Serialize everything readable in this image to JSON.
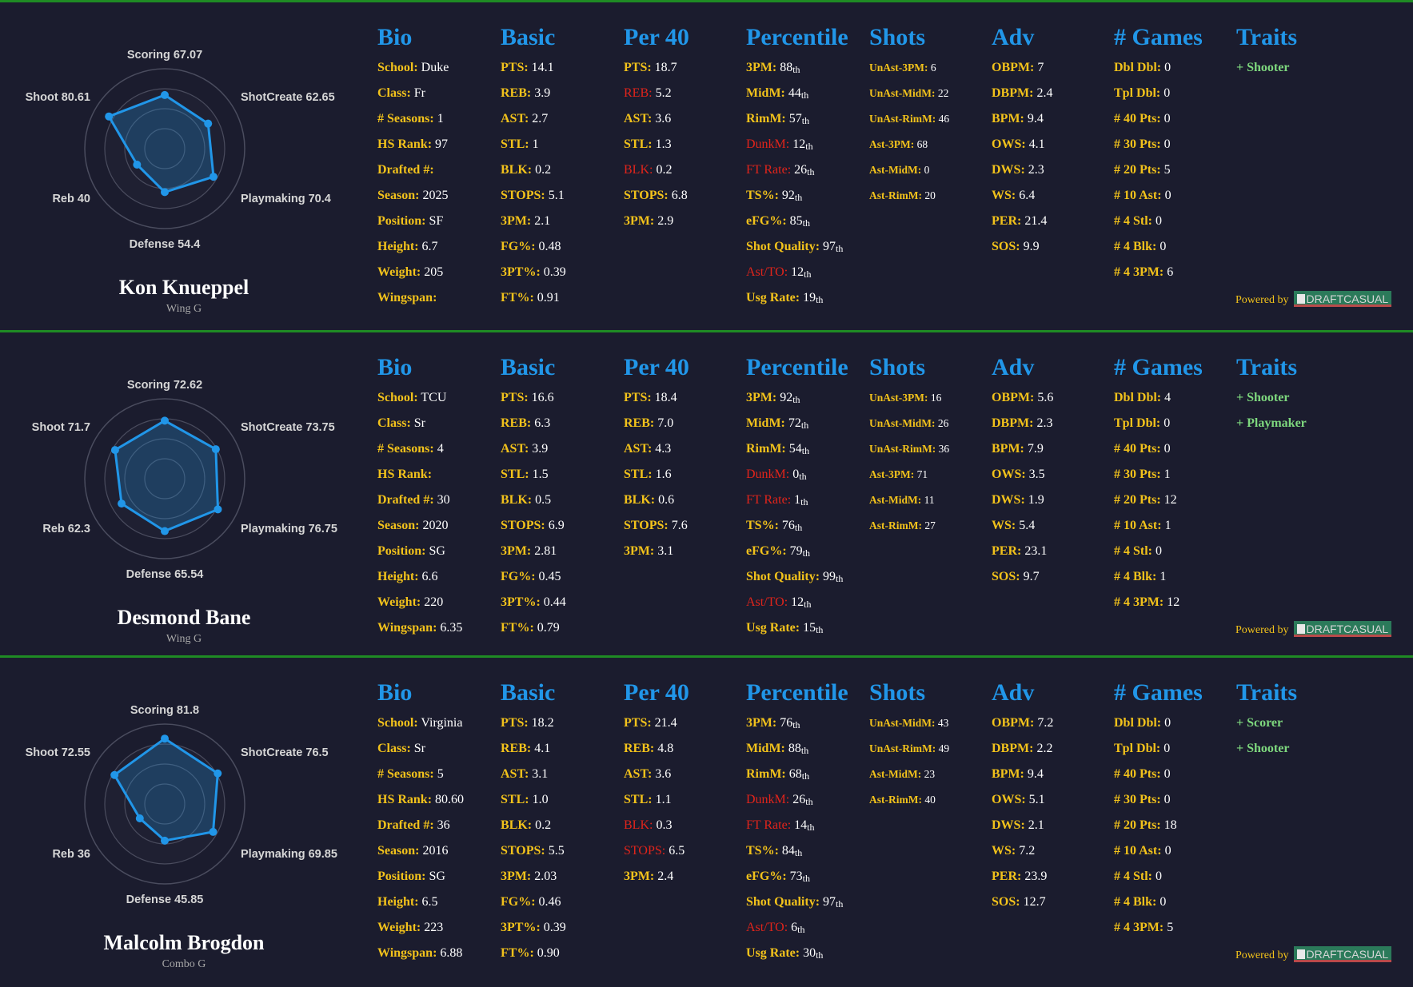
{
  "headers": {
    "bio": "Bio",
    "basic": "Basic",
    "per40": "Per 40",
    "percentile": "Percentile",
    "shots": "Shots",
    "adv": "Adv",
    "games": "# Games",
    "traits": "Traits"
  },
  "powered_by": "Powered by",
  "brand": "DRAFTCASUAL",
  "colors": {
    "background": "#1b1c2e",
    "divider": "#1f8b24",
    "header": "#2196e8",
    "key": "#f2c21b",
    "key_red": "#e0241b",
    "value": "#ffffff",
    "trait": "#7ed87e",
    "radar_line": "#2196e8"
  },
  "radar_axes": [
    "Scoring",
    "ShotCreate",
    "Playmaking",
    "Defense",
    "Reb",
    "Shoot"
  ],
  "players": [
    {
      "name": "Kon Knueppel",
      "position": "Wing G",
      "radar": {
        "scoring": {
          "label": "Scoring 67.07",
          "value": 67.07
        },
        "shotcreate": {
          "label": "ShotCreate 62.65",
          "value": 62.65
        },
        "playmaking": {
          "label": "Playmaking 70.4",
          "value": 70.4
        },
        "defense": {
          "label": "Defense 54.4",
          "value": 54.4
        },
        "reb": {
          "label": "Reb 40",
          "value": 40
        },
        "shoot": {
          "label": "Shoot 80.61",
          "value": 80.61
        }
      },
      "bio": [
        {
          "k": "School:",
          "v": "Duke"
        },
        {
          "k": "Class:",
          "v": "Fr"
        },
        {
          "k": "# Seasons:",
          "v": "1"
        },
        {
          "k": "HS Rank:",
          "v": "97"
        },
        {
          "k": "Drafted #:",
          "v": ""
        },
        {
          "k": "Season:",
          "v": "2025"
        },
        {
          "k": "Position:",
          "v": "SF"
        },
        {
          "k": "Height:",
          "v": "6.7"
        },
        {
          "k": "Weight:",
          "v": "205"
        },
        {
          "k": "Wingspan:",
          "v": ""
        }
      ],
      "basic": [
        {
          "k": "PTS:",
          "v": "14.1"
        },
        {
          "k": "REB:",
          "v": "3.9"
        },
        {
          "k": "AST:",
          "v": "2.7"
        },
        {
          "k": "STL:",
          "v": "1"
        },
        {
          "k": "BLK:",
          "v": "0.2"
        },
        {
          "k": "STOPS:",
          "v": "5.1"
        },
        {
          "k": "3PM:",
          "v": "2.1"
        },
        {
          "k": "FG%:",
          "v": "0.48"
        },
        {
          "k": "3PT%:",
          "v": "0.39"
        },
        {
          "k": "FT%:",
          "v": "0.91"
        }
      ],
      "per40": [
        {
          "k": "PTS:",
          "v": "18.7"
        },
        {
          "k": "REB:",
          "v": "5.2",
          "red": true
        },
        {
          "k": "AST:",
          "v": "3.6"
        },
        {
          "k": "STL:",
          "v": "1.3"
        },
        {
          "k": "BLK:",
          "v": "0.2",
          "red": true
        },
        {
          "k": "STOPS:",
          "v": "6.8"
        },
        {
          "k": "3PM:",
          "v": "2.9"
        }
      ],
      "percentile": [
        {
          "k": "3PM:",
          "n": "88",
          "s": "th"
        },
        {
          "k": "MidM:",
          "n": "44",
          "s": "th"
        },
        {
          "k": "RimM:",
          "n": "57",
          "s": "th"
        },
        {
          "k": "DunkM:",
          "n": "12",
          "s": "th",
          "red": true
        },
        {
          "k": "FT Rate:",
          "n": "26",
          "s": "th",
          "red": true
        },
        {
          "k": "TS%:",
          "n": "92",
          "s": "th"
        },
        {
          "k": "eFG%:",
          "n": "85",
          "s": "th"
        },
        {
          "k": "Shot Quality:",
          "n": "97",
          "s": "th"
        },
        {
          "k": "Ast/TO:",
          "n": "12",
          "s": "th",
          "red": true
        },
        {
          "k": "Usg Rate:",
          "n": "19",
          "s": "th"
        }
      ],
      "shots": [
        {
          "k": "UnAst-3PM:",
          "v": "6"
        },
        {
          "k": "UnAst-MidM:",
          "v": "22"
        },
        {
          "k": "UnAst-RimM:",
          "v": "46"
        },
        {
          "k": "Ast-3PM:",
          "v": "68"
        },
        {
          "k": "Ast-MidM:",
          "v": "0"
        },
        {
          "k": "Ast-RimM:",
          "v": "20"
        }
      ],
      "adv": [
        {
          "k": "OBPM:",
          "v": "7"
        },
        {
          "k": "DBPM:",
          "v": "2.4"
        },
        {
          "k": "BPM:",
          "v": "9.4"
        },
        {
          "k": "OWS:",
          "v": "4.1"
        },
        {
          "k": "DWS:",
          "v": "2.3"
        },
        {
          "k": "WS:",
          "v": "6.4"
        },
        {
          "k": "PER:",
          "v": "21.4"
        },
        {
          "k": "SOS:",
          "v": "9.9"
        }
      ],
      "games": [
        {
          "k": "Dbl Dbl:",
          "v": "0"
        },
        {
          "k": "Tpl Dbl:",
          "v": "0"
        },
        {
          "k": "# 40 Pts:",
          "v": "0"
        },
        {
          "k": "# 30 Pts:",
          "v": "0"
        },
        {
          "k": "# 20 Pts:",
          "v": "5"
        },
        {
          "k": "# 10 Ast:",
          "v": "0"
        },
        {
          "k": "# 4 Stl:",
          "v": "0"
        },
        {
          "k": "# 4 Blk:",
          "v": "0"
        },
        {
          "k": "# 4 3PM:",
          "v": "6"
        }
      ],
      "traits": [
        "+ Shooter"
      ]
    },
    {
      "name": "Desmond Bane",
      "position": "Wing G",
      "radar": {
        "scoring": {
          "label": "Scoring 72.62",
          "value": 72.62
        },
        "shotcreate": {
          "label": "ShotCreate 73.75",
          "value": 73.75
        },
        "playmaking": {
          "label": "Playmaking 76.75",
          "value": 76.75
        },
        "defense": {
          "label": "Defense 65.54",
          "value": 65.54
        },
        "reb": {
          "label": "Reb 62.3",
          "value": 62.3
        },
        "shoot": {
          "label": "Shoot 71.7",
          "value": 71.7
        }
      },
      "bio": [
        {
          "k": "School:",
          "v": "TCU"
        },
        {
          "k": "Class:",
          "v": "Sr"
        },
        {
          "k": "# Seasons:",
          "v": "4"
        },
        {
          "k": "HS Rank:",
          "v": ""
        },
        {
          "k": "Drafted #:",
          "v": "30"
        },
        {
          "k": "Season:",
          "v": "2020"
        },
        {
          "k": "Position:",
          "v": "SG"
        },
        {
          "k": "Height:",
          "v": "6.6"
        },
        {
          "k": "Weight:",
          "v": "220"
        },
        {
          "k": "Wingspan:",
          "v": "6.35"
        }
      ],
      "basic": [
        {
          "k": "PTS:",
          "v": "16.6"
        },
        {
          "k": "REB:",
          "v": "6.3"
        },
        {
          "k": "AST:",
          "v": "3.9"
        },
        {
          "k": "STL:",
          "v": "1.5"
        },
        {
          "k": "BLK:",
          "v": "0.5"
        },
        {
          "k": "STOPS:",
          "v": "6.9"
        },
        {
          "k": "3PM:",
          "v": "2.81"
        },
        {
          "k": "FG%:",
          "v": "0.45"
        },
        {
          "k": "3PT%:",
          "v": "0.44"
        },
        {
          "k": "FT%:",
          "v": "0.79"
        }
      ],
      "per40": [
        {
          "k": "PTS:",
          "v": "18.4"
        },
        {
          "k": "REB:",
          "v": "7.0"
        },
        {
          "k": "AST:",
          "v": "4.3"
        },
        {
          "k": "STL:",
          "v": "1.6"
        },
        {
          "k": "BLK:",
          "v": "0.6"
        },
        {
          "k": "STOPS:",
          "v": "7.6"
        },
        {
          "k": "3PM:",
          "v": "3.1"
        }
      ],
      "percentile": [
        {
          "k": "3PM:",
          "n": "92",
          "s": "th"
        },
        {
          "k": "MidM:",
          "n": "72",
          "s": "th"
        },
        {
          "k": "RimM:",
          "n": "54",
          "s": "th"
        },
        {
          "k": "DunkM:",
          "n": "0",
          "s": "th",
          "red": true
        },
        {
          "k": "FT Rate:",
          "n": "1",
          "s": "th",
          "red": true
        },
        {
          "k": "TS%:",
          "n": "76",
          "s": "th"
        },
        {
          "k": "eFG%:",
          "n": "79",
          "s": "th"
        },
        {
          "k": "Shot Quality:",
          "n": "99",
          "s": "th"
        },
        {
          "k": "Ast/TO:",
          "n": "12",
          "s": "th",
          "red": true
        },
        {
          "k": "Usg Rate:",
          "n": "15",
          "s": "th"
        }
      ],
      "shots": [
        {
          "k": "UnAst-3PM:",
          "v": "16"
        },
        {
          "k": "UnAst-MidM:",
          "v": "26"
        },
        {
          "k": "UnAst-RimM:",
          "v": "36"
        },
        {
          "k": "Ast-3PM:",
          "v": "71"
        },
        {
          "k": "Ast-MidM:",
          "v": "11"
        },
        {
          "k": "Ast-RimM:",
          "v": "27"
        }
      ],
      "adv": [
        {
          "k": "OBPM:",
          "v": "5.6"
        },
        {
          "k": "DBPM:",
          "v": "2.3"
        },
        {
          "k": "BPM:",
          "v": "7.9"
        },
        {
          "k": "OWS:",
          "v": "3.5"
        },
        {
          "k": "DWS:",
          "v": "1.9"
        },
        {
          "k": "WS:",
          "v": "5.4"
        },
        {
          "k": "PER:",
          "v": "23.1"
        },
        {
          "k": "SOS:",
          "v": "9.7"
        }
      ],
      "games": [
        {
          "k": "Dbl Dbl:",
          "v": "4"
        },
        {
          "k": "Tpl Dbl:",
          "v": "0"
        },
        {
          "k": "# 40 Pts:",
          "v": "0"
        },
        {
          "k": "# 30 Pts:",
          "v": "1"
        },
        {
          "k": "# 20 Pts:",
          "v": "12"
        },
        {
          "k": "# 10 Ast:",
          "v": "1"
        },
        {
          "k": "# 4 Stl:",
          "v": "0"
        },
        {
          "k": "# 4 Blk:",
          "v": "1"
        },
        {
          "k": "# 4 3PM:",
          "v": "12"
        }
      ],
      "traits": [
        "+ Shooter",
        "+ Playmaker"
      ]
    },
    {
      "name": "Malcolm Brogdon",
      "position": "Combo G",
      "radar": {
        "scoring": {
          "label": "Scoring 81.8",
          "value": 81.8
        },
        "shotcreate": {
          "label": "ShotCreate 76.5",
          "value": 76.5
        },
        "playmaking": {
          "label": "Playmaking 69.85",
          "value": 69.85
        },
        "defense": {
          "label": "Defense 45.85",
          "value": 45.85
        },
        "reb": {
          "label": "Reb 36",
          "value": 36
        },
        "shoot": {
          "label": "Shoot 72.55",
          "value": 72.55
        }
      },
      "bio": [
        {
          "k": "School:",
          "v": "Virginia"
        },
        {
          "k": "Class:",
          "v": "Sr"
        },
        {
          "k": "# Seasons:",
          "v": "5"
        },
        {
          "k": "HS Rank:",
          "v": "80.60"
        },
        {
          "k": "Drafted #:",
          "v": "36"
        },
        {
          "k": "Season:",
          "v": "2016"
        },
        {
          "k": "Position:",
          "v": "SG"
        },
        {
          "k": "Height:",
          "v": "6.5"
        },
        {
          "k": "Weight:",
          "v": "223"
        },
        {
          "k": "Wingspan:",
          "v": "6.88"
        }
      ],
      "basic": [
        {
          "k": "PTS:",
          "v": "18.2"
        },
        {
          "k": "REB:",
          "v": "4.1"
        },
        {
          "k": "AST:",
          "v": "3.1"
        },
        {
          "k": "STL:",
          "v": "1.0"
        },
        {
          "k": "BLK:",
          "v": "0.2"
        },
        {
          "k": "STOPS:",
          "v": "5.5"
        },
        {
          "k": "3PM:",
          "v": "2.03"
        },
        {
          "k": "FG%:",
          "v": "0.46"
        },
        {
          "k": "3PT%:",
          "v": "0.39"
        },
        {
          "k": "FT%:",
          "v": "0.90"
        }
      ],
      "per40": [
        {
          "k": "PTS:",
          "v": "21.4"
        },
        {
          "k": "REB:",
          "v": "4.8"
        },
        {
          "k": "AST:",
          "v": "3.6"
        },
        {
          "k": "STL:",
          "v": "1.1"
        },
        {
          "k": "BLK:",
          "v": "0.3",
          "red": true
        },
        {
          "k": "STOPS:",
          "v": "6.5",
          "red": true
        },
        {
          "k": "3PM:",
          "v": "2.4"
        }
      ],
      "percentile": [
        {
          "k": "3PM:",
          "n": "76",
          "s": "th"
        },
        {
          "k": "MidM:",
          "n": "88",
          "s": "th"
        },
        {
          "k": "RimM:",
          "n": "68",
          "s": "th"
        },
        {
          "k": "DunkM:",
          "n": "26",
          "s": "th",
          "red": true
        },
        {
          "k": "FT Rate:",
          "n": "14",
          "s": "th",
          "red": true
        },
        {
          "k": "TS%:",
          "n": "84",
          "s": "th"
        },
        {
          "k": "eFG%:",
          "n": "73",
          "s": "th"
        },
        {
          "k": "Shot Quality:",
          "n": "97",
          "s": "th"
        },
        {
          "k": "Ast/TO:",
          "n": "6",
          "s": "th",
          "red": true
        },
        {
          "k": "Usg Rate:",
          "n": "30",
          "s": "th"
        }
      ],
      "shots": [
        {
          "k": "UnAst-MidM:",
          "v": "43"
        },
        {
          "k": "UnAst-RimM:",
          "v": "49"
        },
        {
          "k": "Ast-MidM:",
          "v": "23"
        },
        {
          "k": "Ast-RimM:",
          "v": "40"
        }
      ],
      "adv": [
        {
          "k": "OBPM:",
          "v": "7.2"
        },
        {
          "k": "DBPM:",
          "v": "2.2"
        },
        {
          "k": "BPM:",
          "v": "9.4"
        },
        {
          "k": "OWS:",
          "v": "5.1"
        },
        {
          "k": "DWS:",
          "v": "2.1"
        },
        {
          "k": "WS:",
          "v": "7.2"
        },
        {
          "k": "PER:",
          "v": "23.9"
        },
        {
          "k": "SOS:",
          "v": "12.7"
        }
      ],
      "games": [
        {
          "k": "Dbl Dbl:",
          "v": "0"
        },
        {
          "k": "Tpl Dbl:",
          "v": "0"
        },
        {
          "k": "# 40 Pts:",
          "v": "0"
        },
        {
          "k": "# 30 Pts:",
          "v": "0"
        },
        {
          "k": "# 20 Pts:",
          "v": "18"
        },
        {
          "k": "# 10 Ast:",
          "v": "0"
        },
        {
          "k": "# 4 Stl:",
          "v": "0"
        },
        {
          "k": "# 4 Blk:",
          "v": "0"
        },
        {
          "k": "# 4 3PM:",
          "v": "5"
        }
      ],
      "traits": [
        "+ Scorer",
        "+ Shooter"
      ]
    }
  ]
}
